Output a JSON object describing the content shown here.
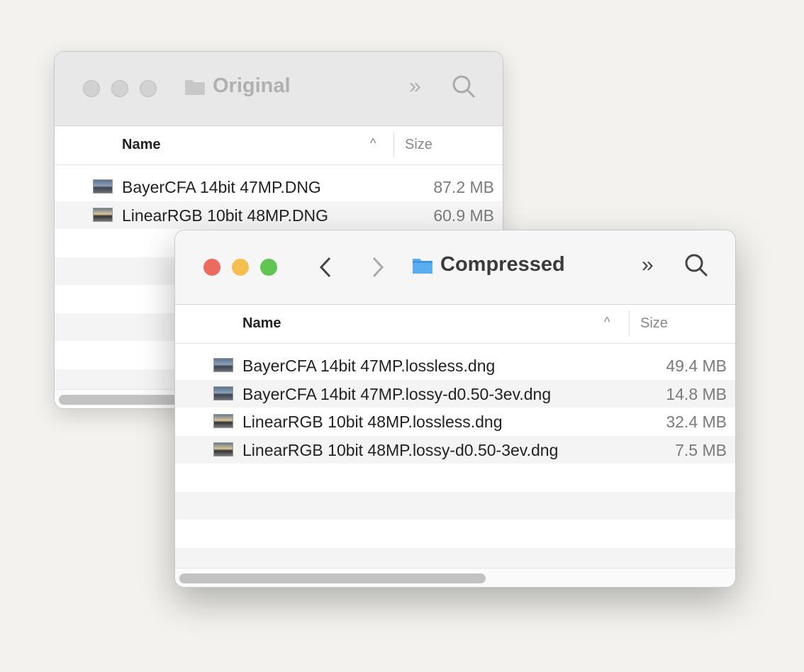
{
  "back_window": {
    "title": "Original",
    "columns": {
      "name": "Name",
      "size": "Size"
    },
    "files": [
      {
        "name": "BayerCFA 14bit 47MP.DNG",
        "size": "87.2 MB"
      },
      {
        "name": "LinearRGB 10bit 48MP.DNG",
        "size": "60.9 MB"
      }
    ]
  },
  "front_window": {
    "title": "Compressed",
    "columns": {
      "name": "Name",
      "size": "Size"
    },
    "files": [
      {
        "name": "BayerCFA 14bit 47MP.lossless.dng",
        "size": "49.4 MB"
      },
      {
        "name": "BayerCFA 14bit 47MP.lossy-d0.50-3ev.dng",
        "size": "14.8 MB"
      },
      {
        "name": "LinearRGB 10bit 48MP.lossless.dng",
        "size": "32.4 MB"
      },
      {
        "name": "LinearRGB 10bit 48MP.lossy-d0.50-3ev.dng",
        "size": "7.5 MB"
      }
    ]
  },
  "colors": {
    "close": "#ec6a5e",
    "minimize": "#f4bf4f",
    "zoom": "#61c554",
    "folder": "#5aaef0"
  }
}
